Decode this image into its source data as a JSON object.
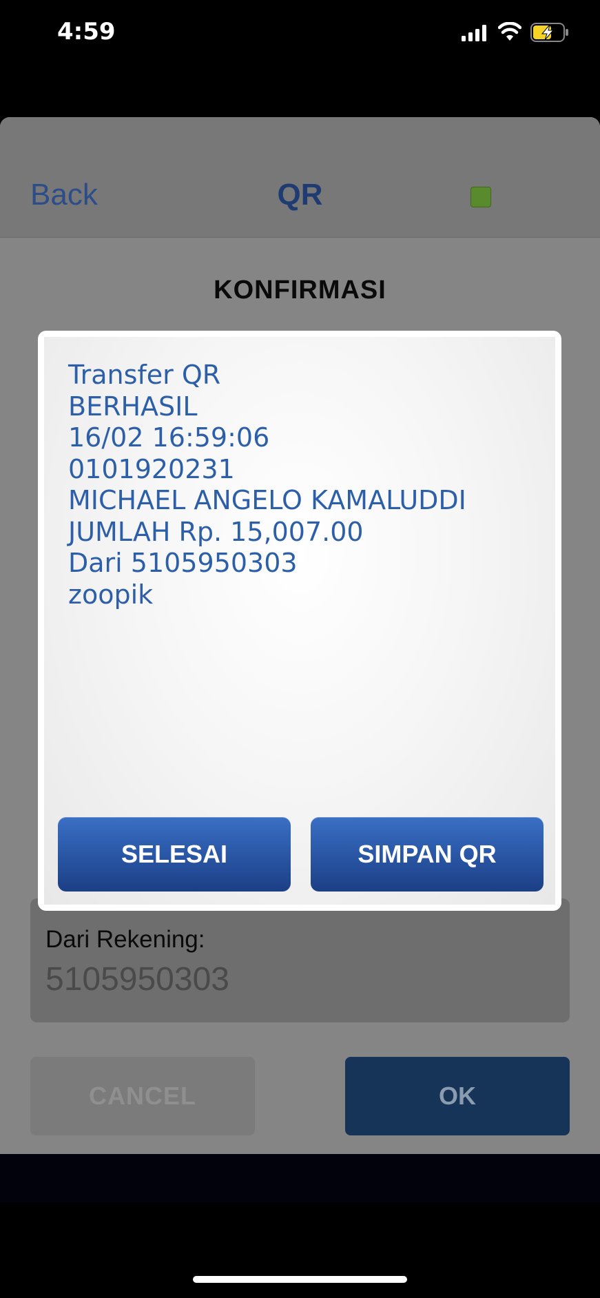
{
  "status_bar": {
    "time": "4:59"
  },
  "nav": {
    "back_label": "Back",
    "title": "QR",
    "indicator_color": "#5a8a2e"
  },
  "page": {
    "heading": "KONFIRMASI"
  },
  "dialog": {
    "lines": [
      "Transfer QR",
      "BERHASIL",
      "16/02 16:59:06",
      "0101920231",
      "MICHAEL ANGELO KAMALUDDI",
      "JUMLAH Rp. 15,007.00",
      "Dari 5105950303",
      "zoopik"
    ],
    "done_label": "SELESAI",
    "save_label": "SIMPAN QR"
  },
  "form": {
    "from_label": "Dari Rekening:",
    "from_value": "5105950303"
  },
  "actions": {
    "cancel_label": "CANCEL",
    "ok_label": "OK"
  }
}
